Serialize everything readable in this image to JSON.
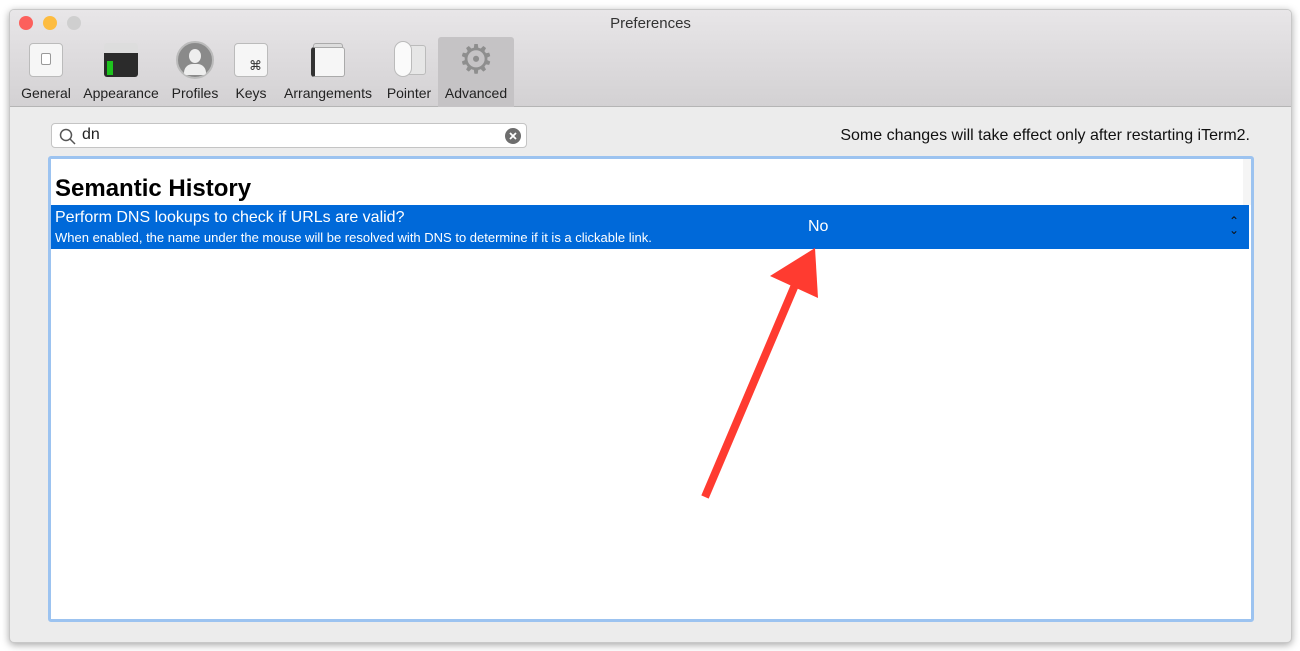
{
  "window": {
    "title": "Preferences"
  },
  "toolbar": {
    "tabs": [
      {
        "label": "General",
        "icon": "switch-icon"
      },
      {
        "label": "Appearance",
        "icon": "terminal-window-icon"
      },
      {
        "label": "Profiles",
        "icon": "user-silhouette-icon"
      },
      {
        "label": "Keys",
        "icon": "command-key-icon"
      },
      {
        "label": "Arrangements",
        "icon": "windows-stack-icon"
      },
      {
        "label": "Pointer",
        "icon": "mouse-icon"
      },
      {
        "label": "Advanced",
        "icon": "gear-icon",
        "selected": true
      }
    ]
  },
  "search": {
    "value": "dn"
  },
  "notice": "Some changes will take effect only after restarting iTerm2.",
  "table": {
    "section": "Semantic History",
    "rows": [
      {
        "title": "Perform DNS lookups to check if URLs are valid?",
        "description": "When enabled, the name under the mouse will be resolved with DNS to determine if it is a clickable link.",
        "value": "No",
        "selected": true
      }
    ]
  },
  "colors": {
    "selection": "#0069d9",
    "annotation_arrow": "#ff3b30"
  }
}
